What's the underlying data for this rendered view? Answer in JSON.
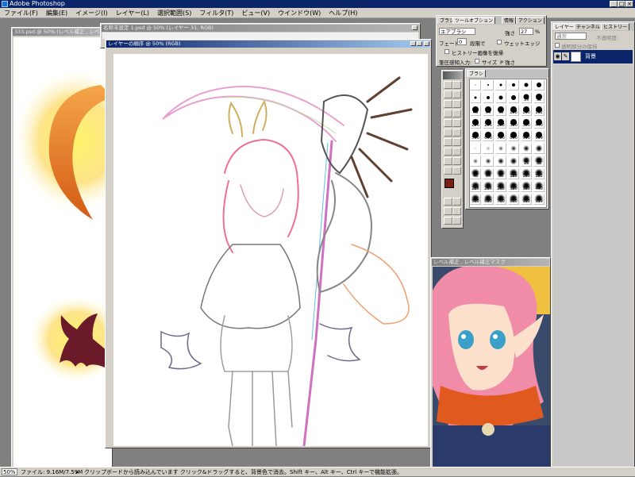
{
  "app": {
    "title": "Adobe Photoshop"
  },
  "menu": [
    "ファイル(F)",
    "編集(E)",
    "イメージ(I)",
    "レイヤー(L)",
    "選択範囲(S)",
    "フィルタ(T)",
    "ビュー(V)",
    "ウインドウ(W)",
    "ヘルプ(H)"
  ],
  "documents": {
    "back": {
      "title": "333.psd @ 50% (レベル補正 , レベル補正マスク)"
    },
    "middle": {
      "title": "名称未設定 1.psd @ 50% (レイヤー 31, RGB)"
    },
    "front": {
      "title": "レイヤーの順序 @ 50% (RGB)"
    }
  },
  "tool_options": {
    "tabs": [
      "ブラシ",
      "ツールオプション",
      "情報",
      "アクション"
    ],
    "brush_label": "エアブラシ",
    "strength_label": "強さ",
    "strength_value": "27",
    "strength_unit": "%",
    "fade_label": "フェード",
    "fade_value": "0",
    "fade_unit": "段階で",
    "wet_edge_label": "ウェットエッジ",
    "history_label": "ヒストリー画像を復帰",
    "pressure_label": "筆圧感知入力:",
    "size_label": "サイズ",
    "pressure_label2": "P 強さ"
  },
  "brushes_panel": {
    "tab": "ブラシ",
    "row1": [
      "",
      "",
      "",
      "",
      "",
      ""
    ],
    "row2": [
      "",
      "",
      "",
      "",
      "19",
      "32"
    ],
    "row3": [
      "48",
      "64",
      "96",
      "128",
      "160",
      "192"
    ],
    "row4": [
      "226",
      "256",
      "288",
      "320",
      "380",
      "440"
    ],
    "row5": [
      "500",
      "600",
      "700",
      "800",
      "900",
      "999"
    ],
    "row6": [
      "",
      "",
      "",
      "",
      "",
      ""
    ],
    "row7": [
      "",
      "",
      "",
      "",
      "19",
      "32"
    ],
    "row8": [
      "48",
      "64",
      "96",
      "128",
      "160",
      "192"
    ],
    "row9": [
      "226",
      "256",
      "288",
      "320",
      "380",
      "440"
    ],
    "row10": [
      "500",
      "600",
      "700",
      "800",
      "900",
      "999"
    ]
  },
  "layers": {
    "tabs": [
      "レイヤー",
      "チャンネル",
      "ヒストリー"
    ],
    "mode": "通常",
    "opacity_label": "不透明度:",
    "preserve_label": "透明部分の保持",
    "layer_name": "背景"
  },
  "preview_window": {
    "title": "レベル補正 , レベル補正マスク"
  },
  "status": {
    "zoom": "50%",
    "file": "ファイル: 9.16M/7.59M",
    "arrow": "▸",
    "hint": "クリップボードから読み込んでいます  クリック&ドラッグすると、背景色で消去。Shift キー、Alt キー、Ctrl キーで機能拡張。"
  },
  "colors": {
    "titlebar": "#0a246a",
    "foreground": "#7a1e14",
    "panel": "#d4d0c8"
  }
}
